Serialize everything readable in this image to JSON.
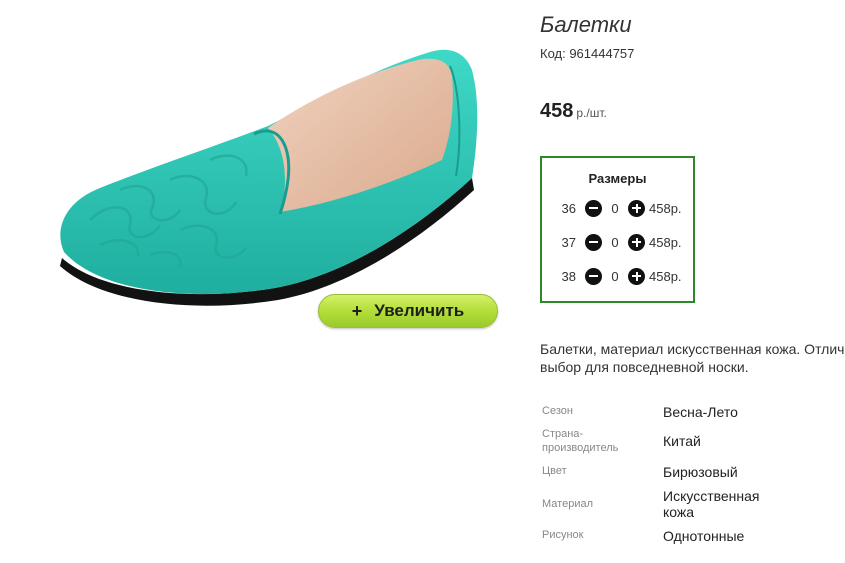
{
  "product": {
    "title": "Балетки",
    "code": "Код: 961444757",
    "price": "458",
    "price_unit": "р./шт.",
    "colors": {
      "accent_border": "#2a8a2a",
      "zoom_button": "#b5e03c",
      "shoe": "#2cc4b4"
    }
  },
  "zoom_button": {
    "icon": "plus",
    "label": "Увеличить"
  },
  "sizes": {
    "title": "Размеры",
    "rows": [
      {
        "size": "36",
        "qty": "0",
        "price": "458р."
      },
      {
        "size": "37",
        "qty": "0",
        "price": "458р."
      },
      {
        "size": "38",
        "qty": "0",
        "price": "458р."
      }
    ]
  },
  "description": "Балетки, материал искусственная кожа. Отлич выбор для повседневной носки.",
  "specs": [
    {
      "label": "Сезон",
      "value": "Весна-Лето"
    },
    {
      "label": "Страна-производитель",
      "value": "Китай"
    },
    {
      "label": "Цвет",
      "value": "Бирюзовый"
    },
    {
      "label": "Материал",
      "value": "Искусственная кожа"
    },
    {
      "label": "Рисунок",
      "value": "Однотонные"
    }
  ]
}
